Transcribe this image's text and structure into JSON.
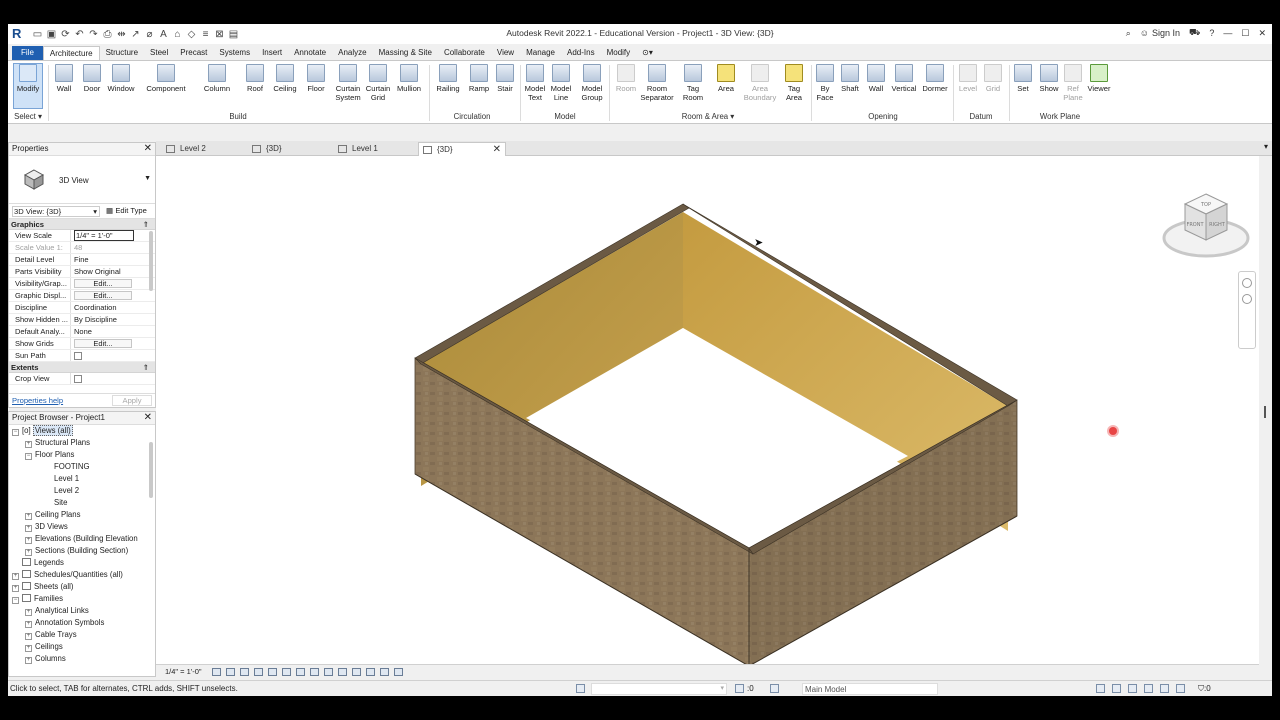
{
  "app": {
    "title": "Autodesk Revit 2022.1 - Educational Version - Project1 - 3D View: {3D}",
    "logo": "R",
    "sign_in": "Sign In",
    "quick_access_icons": [
      "open-icon",
      "save-icon",
      "sync-icon",
      "undo-icon",
      "redo-icon",
      "print-icon",
      "measure-icon",
      "dimension-icon",
      "tag-icon",
      "text-icon",
      "3d-view-icon",
      "section-icon",
      "thin-lines-icon",
      "close-hidden-icon",
      "switch-windows-icon"
    ]
  },
  "ribbon_tabs": [
    "File",
    "Architecture",
    "Structure",
    "Steel",
    "Precast",
    "Systems",
    "Insert",
    "Annotate",
    "Analyze",
    "Massing & Site",
    "Collaborate",
    "View",
    "Manage",
    "Add-Ins",
    "Modify",
    "⊙▾"
  ],
  "active_tab": "Architecture",
  "ribbon": {
    "select_label": "Select ▾",
    "panels": {
      "build": "Build",
      "circulation": "Circulation",
      "model": "Model",
      "room_area": "Room & Area ▾",
      "opening": "Opening",
      "datum": "Datum",
      "work_plane": "Work Plane"
    },
    "buttons": {
      "modify": "Modify",
      "wall": "Wall",
      "door": "Door",
      "window": "Window",
      "component": "Component",
      "column": "Column",
      "roof": "Roof",
      "ceiling": "Ceiling",
      "floor": "Floor",
      "curtain_system": "Curtain System",
      "curtain_grid": "Curtain Grid",
      "mullion": "Mullion",
      "railing": "Railing",
      "ramp": "Ramp",
      "stair": "Stair",
      "model_text": "Model Text",
      "model_line": "Model Line",
      "model_group": "Model Group",
      "room": "Room",
      "room_separator": "Room Separator",
      "tag_room": "Tag Room",
      "area": "Area",
      "area_boundary": "Area Boundary",
      "tag_area": "Tag Area",
      "by_face": "By Face",
      "shaft": "Shaft",
      "wall_opening": "Wall",
      "vertical": "Vertical",
      "dormer": "Dormer",
      "level": "Level",
      "grid": "Grid",
      "set": "Set",
      "show": "Show",
      "ref_plane": "Ref Plane",
      "viewer": "Viewer"
    }
  },
  "view_tabs": [
    {
      "label": "Level 2",
      "active": false
    },
    {
      "label": "{3D}",
      "active": false
    },
    {
      "label": "Level 1",
      "active": false
    },
    {
      "label": "{3D}",
      "active": true
    }
  ],
  "properties": {
    "header": "Properties",
    "type_name": "3D View",
    "instance": "3D View: {3D}",
    "edit_type": "Edit Type",
    "groups": {
      "graphics": "Graphics",
      "extents": "Extents"
    },
    "rows": {
      "view_scale": {
        "k": "View Scale",
        "v": "1/4\" = 1'-0\""
      },
      "scale_value": {
        "k": "Scale Value",
        "s": "1:",
        "v": "48"
      },
      "detail_level": {
        "k": "Detail Level",
        "v": "Fine"
      },
      "parts_visibility": {
        "k": "Parts Visibility",
        "v": "Show Original"
      },
      "visibility_graphics": {
        "k": "Visibility/Grap...",
        "v": "Edit..."
      },
      "graphic_display": {
        "k": "Graphic Displ...",
        "v": "Edit..."
      },
      "discipline": {
        "k": "Discipline",
        "v": "Coordination"
      },
      "show_hidden": {
        "k": "Show Hidden ...",
        "v": "By Discipline"
      },
      "default_analysis": {
        "k": "Default Analy...",
        "v": "None"
      },
      "show_grids": {
        "k": "Show Grids",
        "v": "Edit..."
      },
      "sun_path": {
        "k": "Sun Path"
      },
      "crop_view": {
        "k": "Crop View"
      }
    },
    "help": "Properties help",
    "apply": "Apply"
  },
  "browser": {
    "header": "Project Browser - Project1",
    "items": {
      "views_all": "Views (all)",
      "structural_plans": "Structural Plans",
      "floor_plans": "Floor Plans",
      "footing": "FOOTING",
      "level1": "Level 1",
      "level2": "Level 2",
      "site": "Site",
      "ceiling_plans": "Ceiling Plans",
      "views_3d": "3D Views",
      "elevations": "Elevations (Building Elevation",
      "sections": "Sections (Building Section)",
      "legends": "Legends",
      "schedules": "Schedules/Quantities (all)",
      "sheets": "Sheets (all)",
      "families": "Families",
      "analytical_links": "Analytical Links",
      "annotation_symbols": "Annotation Symbols",
      "cable_trays": "Cable Trays",
      "ceilings": "Ceilings",
      "columns": "Columns"
    }
  },
  "viewcube": {
    "top": "TOP",
    "front": "FRONT",
    "right": "RIGHT"
  },
  "view_control": {
    "scale": "1/4\" = 1'-0\""
  },
  "status": {
    "message": "Click to select, TAB for alternates, CTRL adds, SHIFT unselects.",
    "selection_count": ":0",
    "model": "Main Model",
    "filter_count": ":0"
  },
  "colors": {
    "file_tab": "#1f5fb1",
    "wall_exterior": "#8a7458",
    "wall_interior": "#c4a04a",
    "wall_top": "#6b5a44"
  }
}
